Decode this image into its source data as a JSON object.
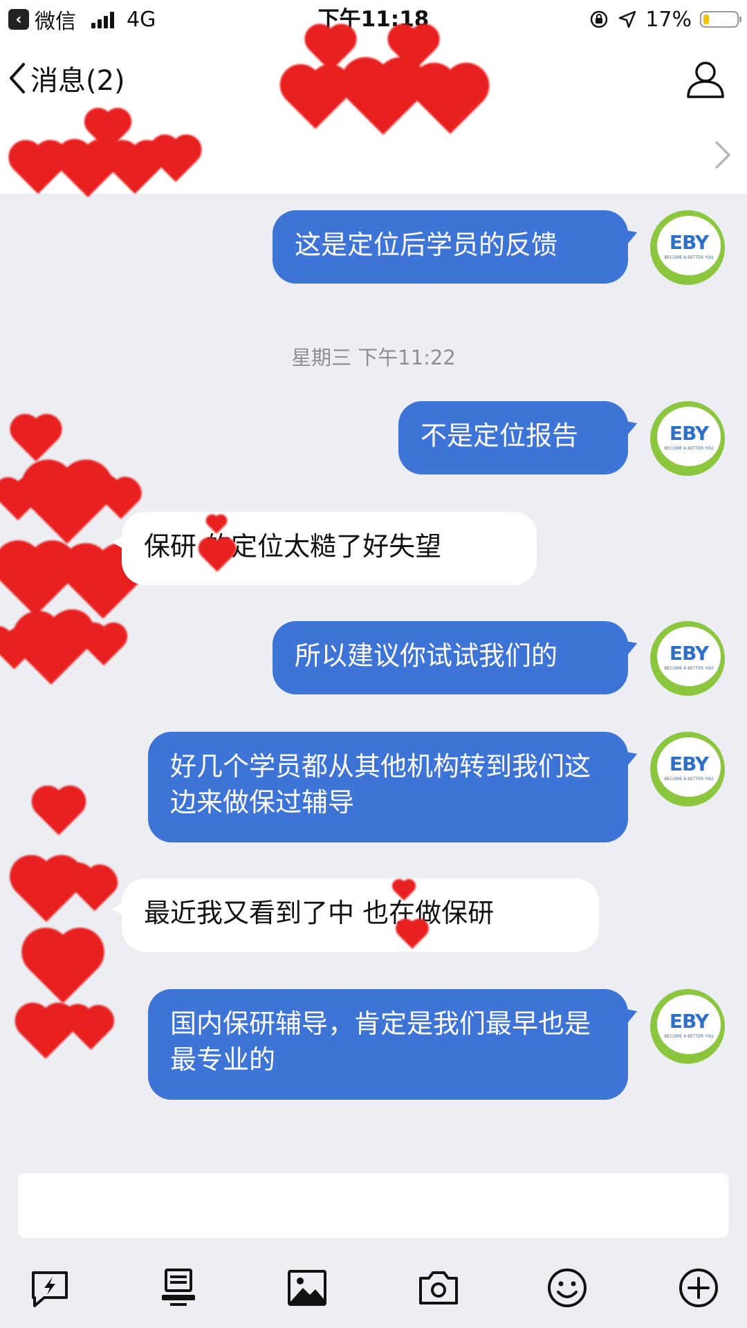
{
  "status_bar": {
    "back_app": "微信",
    "network": "4G",
    "time": "下午11:18",
    "battery": "17%",
    "battery_level": 0.17,
    "battery_color": "#f2c200"
  },
  "nav": {
    "back_label": "消息(2)",
    "profile_icon": "person-icon",
    "chevron_icon": "chevron-right-icon"
  },
  "chat": {
    "timestamp": "星期三 下午11:22",
    "messages": [
      {
        "from": "me",
        "text": "这是定位后学员的反馈"
      },
      {
        "from": "me",
        "text": "不是定位报告"
      },
      {
        "from": "other",
        "text": "保研 的定位太糙了好失望"
      },
      {
        "from": "me",
        "text": "所以建议你试试我们的"
      },
      {
        "from": "me",
        "text": "好几个学员都从其他机构转到我们这边来做保过辅导"
      },
      {
        "from": "other",
        "text": "最近我又看到了中 也在做保研"
      },
      {
        "from": "me",
        "text": "国内保研辅导，肯定是我们最早也是最专业的"
      }
    ],
    "my_avatar": {
      "logo": "EBY",
      "tagline": "BECOME A BETTER YOU"
    },
    "outgoing_color": "#3e74d6",
    "incoming_color": "#ffffff"
  },
  "input": {
    "value": "",
    "placeholder": ""
  },
  "toolbar": {
    "icons": [
      "flash-message-icon",
      "desktop-icon",
      "image-icon",
      "camera-icon",
      "emoji-icon",
      "plus-icon"
    ]
  }
}
